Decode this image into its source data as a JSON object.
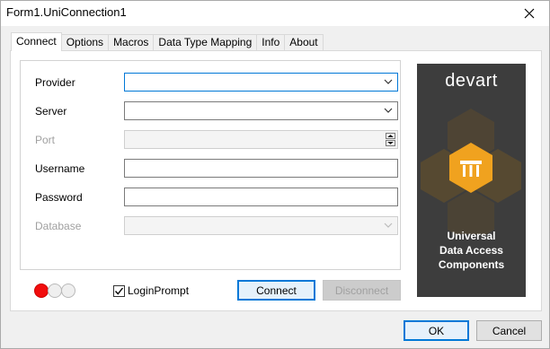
{
  "window": {
    "title": "Form1.UniConnection1",
    "close_glyph": "✕"
  },
  "tabs": [
    {
      "label": "Connect",
      "active": true
    },
    {
      "label": "Options"
    },
    {
      "label": "Macros"
    },
    {
      "label": "Data Type Mapping"
    },
    {
      "label": "Info"
    },
    {
      "label": "About"
    }
  ],
  "form": {
    "provider": {
      "label": "Provider",
      "value": ""
    },
    "server": {
      "label": "Server",
      "value": ""
    },
    "port": {
      "label": "Port",
      "value": ""
    },
    "username": {
      "label": "Username",
      "value": ""
    },
    "password": {
      "label": "Password",
      "value": ""
    },
    "database": {
      "label": "Database",
      "value": ""
    }
  },
  "status_lights": [
    "red",
    "off",
    "off"
  ],
  "login_prompt": {
    "label": "LoginPrompt",
    "checked": true
  },
  "buttons": {
    "connect": "Connect",
    "disconnect": "Disconnect",
    "ok": "OK",
    "cancel": "Cancel"
  },
  "logo": {
    "brand": "devart",
    "caption_line1": "Universal",
    "caption_line2": "Data Access",
    "caption_line3": "Components",
    "bg_color": "#3d3d3d",
    "accent_color": "#f0a21f"
  }
}
